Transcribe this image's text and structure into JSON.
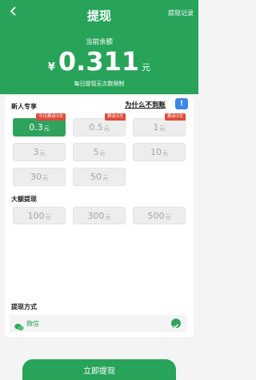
{
  "header": {
    "back_icon": "back-arrow-icon",
    "title": "提现",
    "records_link": "提现记录",
    "balance_label": "当前余额",
    "currency_symbol": "¥",
    "balance_amount": "0.311",
    "balance_unit": "元",
    "balance_note": "每日提现无次数限制"
  },
  "new_user": {
    "title": "新人专享",
    "why_link": "为什么不到账",
    "why_icon": "info-icon",
    "options": [
      {
        "amount": "0.3",
        "unit": "元",
        "badge": "今日剩余3次",
        "active": true
      },
      {
        "amount": "0.5",
        "unit": "元",
        "badge": "剩余3次",
        "active": false
      },
      {
        "amount": "1",
        "unit": "元",
        "badge": "剩余3次",
        "active": false
      },
      {
        "amount": "3",
        "unit": "元",
        "badge": "",
        "active": false
      },
      {
        "amount": "5",
        "unit": "元",
        "badge": "",
        "active": false
      },
      {
        "amount": "10",
        "unit": "元",
        "badge": "",
        "active": false
      },
      {
        "amount": "30",
        "unit": "元",
        "badge": "",
        "active": false
      },
      {
        "amount": "50",
        "unit": "元",
        "badge": "",
        "active": false
      }
    ]
  },
  "large": {
    "title": "大额提现",
    "options": [
      {
        "amount": "100",
        "unit": "元"
      },
      {
        "amount": "300",
        "unit": "元"
      },
      {
        "amount": "500",
        "unit": "元"
      }
    ]
  },
  "method": {
    "title": "提现方式",
    "option_label": "微信",
    "option_icon": "wechat-icon",
    "selected_icon": "check-circle-icon"
  },
  "submit_label": "立即提现",
  "colors": {
    "brand": "#27a35a",
    "badge": "#e04a3a",
    "info": "#3b86e8"
  }
}
